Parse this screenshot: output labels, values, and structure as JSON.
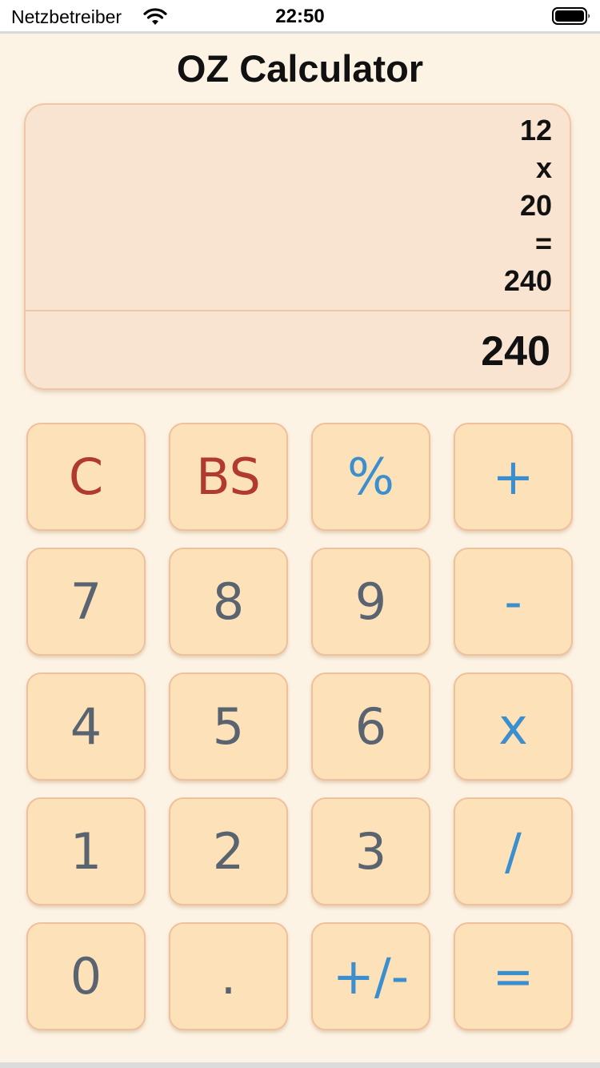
{
  "status_bar": {
    "carrier": "Netzbetreiber",
    "time": "22:50",
    "wifi_icon": "wifi-icon",
    "battery_icon": "battery-icon"
  },
  "app": {
    "title": "OZ Calculator"
  },
  "display": {
    "history": [
      "12",
      "x",
      "20",
      "=",
      "240"
    ],
    "result": "240"
  },
  "keypad": {
    "keys": [
      {
        "label": "C",
        "name": "clear-button",
        "color": "#b03a2e"
      },
      {
        "label": "BS",
        "name": "backspace-button",
        "color": "#b03a2e"
      },
      {
        "label": "%",
        "name": "percent-button",
        "color": "#3b8fce"
      },
      {
        "label": "+",
        "name": "add-button",
        "color": "#3b8fce"
      },
      {
        "label": "7",
        "name": "digit-7-button",
        "color": "#5a6470"
      },
      {
        "label": "8",
        "name": "digit-8-button",
        "color": "#5a6470"
      },
      {
        "label": "9",
        "name": "digit-9-button",
        "color": "#5a6470"
      },
      {
        "label": "-",
        "name": "subtract-button",
        "color": "#3b8fce"
      },
      {
        "label": "4",
        "name": "digit-4-button",
        "color": "#5a6470"
      },
      {
        "label": "5",
        "name": "digit-5-button",
        "color": "#5a6470"
      },
      {
        "label": "6",
        "name": "digit-6-button",
        "color": "#5a6470"
      },
      {
        "label": "x",
        "name": "multiply-button",
        "color": "#3b8fce"
      },
      {
        "label": "1",
        "name": "digit-1-button",
        "color": "#5a6470"
      },
      {
        "label": "2",
        "name": "digit-2-button",
        "color": "#5a6470"
      },
      {
        "label": "3",
        "name": "digit-3-button",
        "color": "#5a6470"
      },
      {
        "label": "/",
        "name": "divide-button",
        "color": "#3b8fce"
      },
      {
        "label": "0",
        "name": "digit-0-button",
        "color": "#5a6470"
      },
      {
        "label": ".",
        "name": "decimal-button",
        "color": "#5a6470"
      },
      {
        "label": "+/-",
        "name": "negate-button",
        "color": "#3b8fce"
      },
      {
        "label": "=",
        "name": "equals-button",
        "color": "#3b8fce"
      }
    ]
  },
  "colors": {
    "background": "#fdf3e4",
    "key_fill": "#fde1b8",
    "display_fill": "#f8e4d1",
    "operator": "#3b8fce",
    "control": "#b03a2e",
    "digit": "#5a6470"
  }
}
